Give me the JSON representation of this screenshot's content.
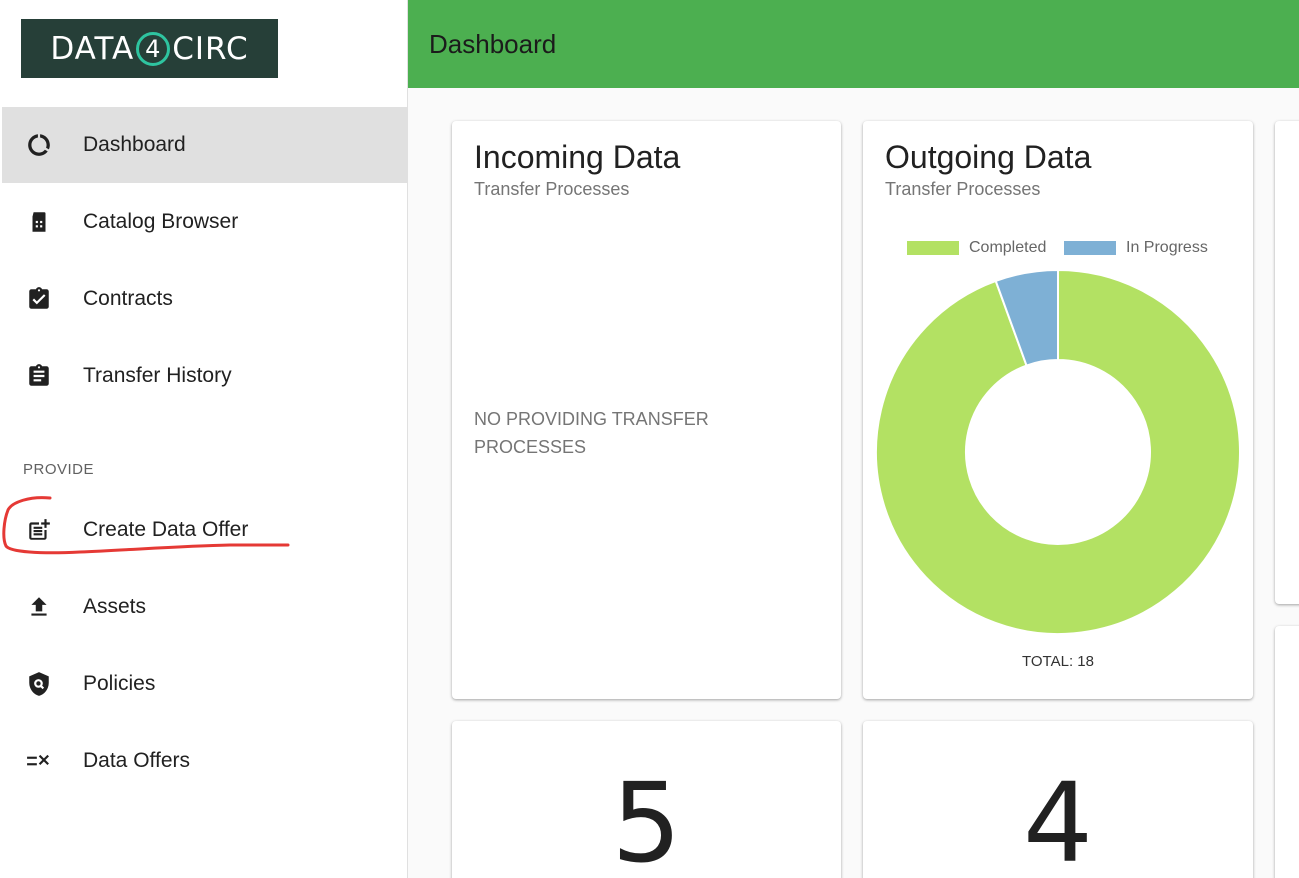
{
  "sidebar": {
    "logo": {
      "left": "DATA",
      "mid": "4",
      "right": "CIRC"
    },
    "items": [
      {
        "label": "Dashboard",
        "icon": "dashboard-ring-icon"
      },
      {
        "label": "Catalog Browser",
        "icon": "catalog-building-icon"
      },
      {
        "label": "Contracts",
        "icon": "clipboard-check-icon"
      },
      {
        "label": "Transfer History",
        "icon": "clipboard-list-icon"
      }
    ],
    "section": "PROVIDE",
    "provide_items": [
      {
        "label": "Create Data Offer",
        "icon": "post-add-icon"
      },
      {
        "label": "Assets",
        "icon": "upload-icon"
      },
      {
        "label": "Policies",
        "icon": "policy-shield-icon"
      },
      {
        "label": "Data Offers",
        "icon": "rule-list-icon"
      }
    ]
  },
  "header": {
    "title": "Dashboard"
  },
  "cards": {
    "incoming": {
      "title": "Incoming Data",
      "subtitle": "Transfer Processes",
      "empty_text": "NO PROVIDING TRANSFER PROCESSES"
    },
    "outgoing": {
      "title": "Outgoing Data",
      "subtitle": "Transfer Processes",
      "total_label": "TOTAL: 18"
    },
    "count_left": {
      "value": "5"
    },
    "count_right": {
      "value": "4"
    }
  },
  "chart_data": {
    "type": "pie",
    "donut": true,
    "categories": [
      "Completed",
      "In Progress"
    ],
    "values": [
      17,
      1
    ],
    "colors": [
      "#b3e163",
      "#7eb0d5"
    ],
    "legend_position": "top",
    "total": 18
  },
  "colors": {
    "header": "#4caf50",
    "active_nav": "#e0e0e0",
    "logo_bg": "#263f38",
    "annotation": "#e53935"
  }
}
